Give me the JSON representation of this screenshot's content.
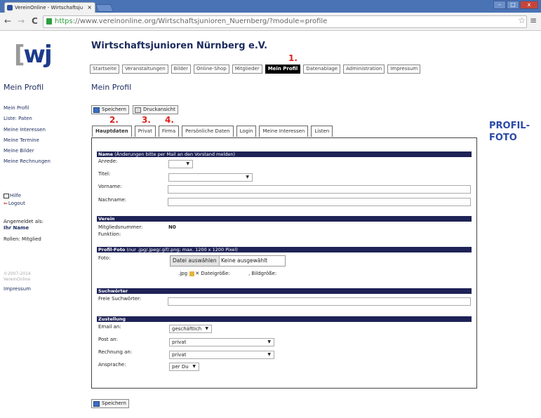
{
  "browser": {
    "tab_title": "VereinOnline - Wirtschaftsju",
    "tab_close": "×",
    "win_min": "–",
    "win_max": "□",
    "win_close": "x",
    "url_https": "https",
    "url_rest": "://www.vereinonline.org/Wirtschaftsjunioren_Nuernberg/?module=profile",
    "nav_back": "←",
    "nav_forward": "→",
    "nav_reload": "C",
    "star": "☆",
    "menu": "≡"
  },
  "logo": {
    "bracket_left": "[",
    "letters": "wj"
  },
  "site": {
    "title": "Wirtschaftsjunioren Nürnberg e.V."
  },
  "topnav": [
    "Startseite",
    "Veranstaltungen",
    "Bilder",
    "Online-Shop",
    "Mitglieder",
    "Mein Profil",
    "Datenablage",
    "Administration",
    "Impressum"
  ],
  "markers": {
    "m1": "1.",
    "m2": "2.",
    "m3": "3.",
    "m4": "4."
  },
  "sidebar": {
    "heading": "Mein Profil",
    "links": [
      "Mein Profil",
      "Liste: Paten",
      "Meine Interessen",
      "Meine Termine",
      "Meine Bilder",
      "Meine Rechnungen"
    ],
    "help": "Hilfe",
    "logout": "Logout",
    "logged_in_label": "Angemeldet als:",
    "user_name": "Ihr Name",
    "roles": "Rollen: Mitglied",
    "copyright": "©2007-2014",
    "copyright2": "VereinOnline",
    "impressum": "Impressum"
  },
  "main": {
    "heading": "Mein Profil",
    "save": "Speichern",
    "print": "Druckansicht",
    "tabs": [
      "Hauptdaten",
      "Privat",
      "Firma",
      "Persönliche Daten",
      "Login",
      "Meine Interessen",
      "Listen"
    ],
    "profile_photo_label_1": "PROFIL-",
    "profile_photo_label_2": "FOTO"
  },
  "form": {
    "sec_name": "Name",
    "sec_name_note": " (Änderungen bitte per Mail an den Vorstand melden)",
    "anrede": "Anrede:",
    "titel": "Titel:",
    "vorname": "Vorname:",
    "nachname": "Nachname:",
    "sec_verein": "Verein",
    "mitgliedsnummer": "Mitgliedsnummer:",
    "mitgliedsnummer_val": "N0",
    "funktion": "Funktion:",
    "sec_foto": "Profil-Foto",
    "sec_foto_note": " (nur .jpg/.jpeg/.gif/.png; max. 1200 x 1200 Pixel)",
    "foto": "Foto:",
    "file_button": "Datei auswählen",
    "file_status": "Keine ausgewählt",
    "file_ext": ".jpg",
    "dateigroesse": "Dateigröße:",
    "bildgroesse": ", Bildgröße:",
    "sec_such": "Suchwörter",
    "freie": "Freie Suchwörter:",
    "sec_zust": "Zustellung",
    "email_an": "Email an:",
    "email_val": "geschäftlich",
    "post_an": "Post an:",
    "post_val": "privat",
    "rechnung_an": "Rechnung an:",
    "rechnung_val": "privat",
    "ansprache": "Ansprache:",
    "ansprache_val": "per Du"
  }
}
